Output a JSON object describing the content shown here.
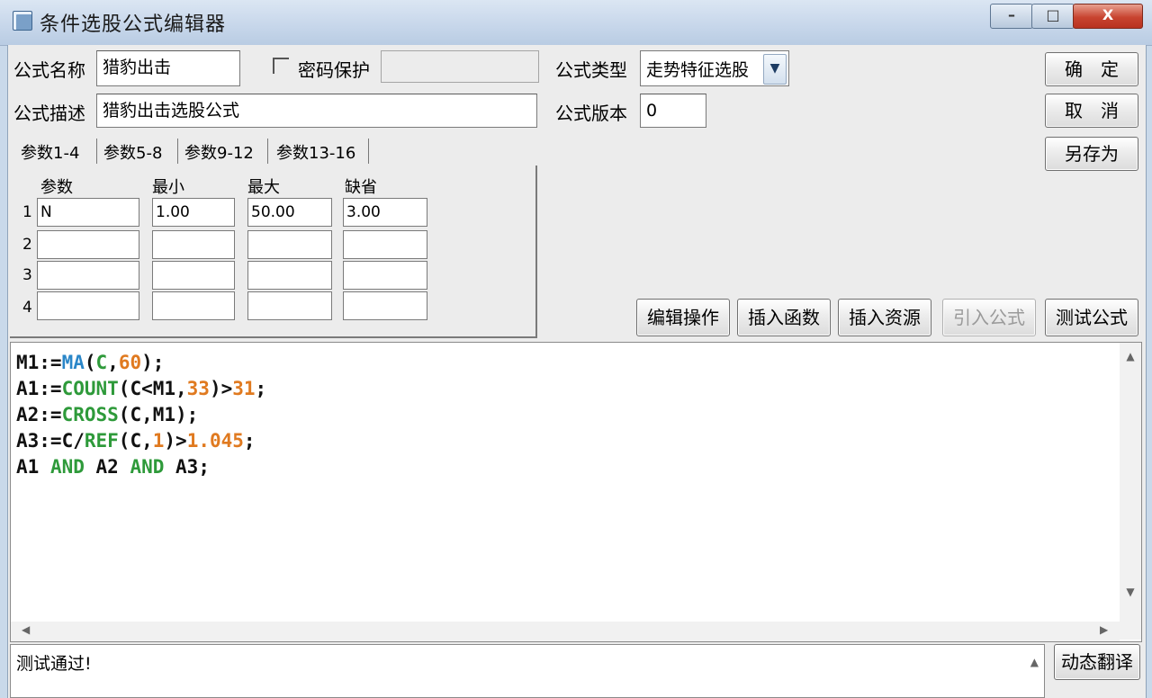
{
  "window": {
    "title": "条件选股公式编辑器",
    "minimize_glyph": "–",
    "maximize_glyph": "□",
    "close_glyph": "X"
  },
  "form": {
    "name_label": "公式名称",
    "name_value": "猎豹出击",
    "password_label": "密码保护",
    "password_value": "",
    "type_label": "公式类型",
    "type_value": "走势特征选股",
    "desc_label": "公式描述",
    "desc_value": "猎豹出击选股公式",
    "version_label": "公式版本",
    "version_value": "0"
  },
  "buttons": {
    "ok": "确　定",
    "cancel": "取　消",
    "save_as": "另存为",
    "edit_ops": "编辑操作",
    "insert_func": "插入函数",
    "insert_res": "插入资源",
    "import": "引入公式",
    "test": "测试公式",
    "dynamic_translate": "动态翻译"
  },
  "tabs": [
    {
      "label": "参数1-4"
    },
    {
      "label": "参数5-8"
    },
    {
      "label": "参数9-12"
    },
    {
      "label": "参数13-16"
    }
  ],
  "params": {
    "headers": [
      "参数",
      "最小",
      "最大",
      "缺省"
    ],
    "rows": [
      {
        "num": "1",
        "name": "N",
        "min": "1.00",
        "max": "50.00",
        "default": "3.00"
      },
      {
        "num": "2",
        "name": "",
        "min": "",
        "max": "",
        "default": ""
      },
      {
        "num": "3",
        "name": "",
        "min": "",
        "max": "",
        "default": ""
      },
      {
        "num": "4",
        "name": "",
        "min": "",
        "max": "",
        "default": ""
      }
    ]
  },
  "code": {
    "l1": {
      "a": "M1:=",
      "b": "MA",
      "c": "(",
      "d": "C",
      "e": ",",
      "f": "60",
      "g": ");"
    },
    "l2": {
      "a": "A1:=",
      "b": "COUNT",
      "c": "(C<M1,",
      "d": "33",
      "e": ")>",
      "f": "31",
      "g": ";"
    },
    "l3": {
      "a": "A2:=",
      "b": "CROSS",
      "c": "(C,M1);"
    },
    "l4": {
      "a": "A3:=C/",
      "b": "REF",
      "c": "(C,",
      "d": "1",
      "e": ")>",
      "f": "1.045",
      "g": ";"
    },
    "l5": {
      "a": "A1 ",
      "b": "AND",
      "c": " A2 ",
      "d": "AND",
      "e": " A3;"
    }
  },
  "status": {
    "message": "测试通过!"
  },
  "colors": {
    "function": "#2e9a3a",
    "builtin": "#2a86c8",
    "number": "#e07a20"
  }
}
